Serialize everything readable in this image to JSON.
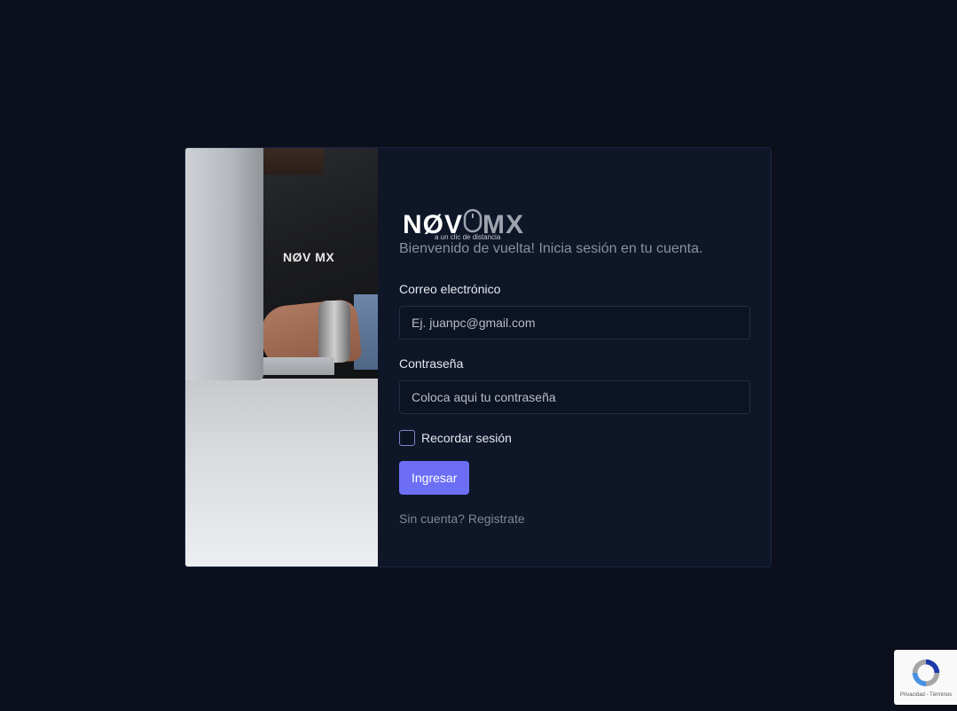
{
  "brand": {
    "logo_left": "NØV",
    "logo_right": "MX",
    "tagline": "a un clic de distancia",
    "vest_logo": "NØV MX"
  },
  "login": {
    "welcome": "Bienvenido de vuelta! Inicia sesión en tu cuenta.",
    "email_label": "Correo electrónico",
    "email_placeholder": "Ej. juanpc@gmail.com",
    "password_label": "Contraseña",
    "password_placeholder": "Coloca aqui tu contraseña",
    "remember_label": "Recordar sesión",
    "submit_label": "Ingresar",
    "register_link": "Sin cuenta? Registrate"
  },
  "recaptcha": {
    "terms": "Privacidad - Términos"
  },
  "colors": {
    "background": "#0b101c",
    "card": "#0e1628",
    "accent": "#6c6ff6"
  }
}
